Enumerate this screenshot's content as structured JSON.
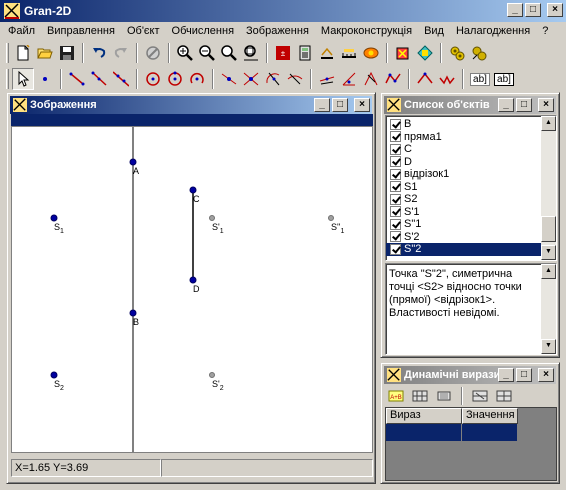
{
  "app": {
    "title": "Gran-2D"
  },
  "menu": {
    "items": [
      "Файл",
      "Виправлення",
      "Об'єкт",
      "Обчислення",
      "Зображення",
      "Макроконструкція",
      "Вид",
      "Налагодження",
      "?"
    ]
  },
  "toolbar1": {
    "icons": [
      "new-file-icon",
      "open-folder-icon",
      "save-icon",
      "undo-icon",
      "redo-icon",
      "disabled-tool-icon",
      "zoom-in-icon",
      "zoom-out-icon",
      "zoom-fit-icon",
      "zoom-window-icon",
      "calculator-icon",
      "measure-icon",
      "ruler-icon",
      "eye-icon",
      "cube-icon",
      "transform-icon",
      "macro-run-icon",
      "macro-settings-icon"
    ]
  },
  "toolbar2": {
    "icons": [
      "arrow-select-icon",
      "point-icon",
      "segment-icon",
      "ray-icon",
      "line-icon",
      "circle-icon",
      "circle-center-icon",
      "arc-icon",
      "point-on-line-icon",
      "intersection-icon",
      "parallel-icon",
      "perpendicular-icon",
      "bisector-icon",
      "angle-icon",
      "polygon-icon",
      "polyline-icon",
      "triangle-icon",
      "reflect-icon"
    ],
    "text_button_1": "ab]",
    "text_button_2": "ab]"
  },
  "drawing": {
    "title": "Зображення",
    "points": [
      {
        "label": "A",
        "sub": "",
        "style": "blue"
      },
      {
        "label": "B",
        "sub": "",
        "style": "blue"
      },
      {
        "label": "C",
        "sub": "",
        "style": "blue"
      },
      {
        "label": "D",
        "sub": "",
        "style": "blue"
      },
      {
        "label": "S",
        "sub": "1",
        "style": "blue"
      },
      {
        "label": "S'",
        "sub": "1",
        "style": "gray"
      },
      {
        "label": "S''",
        "sub": "1",
        "style": "gray"
      },
      {
        "label": "S",
        "sub": "2",
        "style": "blue"
      },
      {
        "label": "S'",
        "sub": "2",
        "style": "gray"
      }
    ],
    "status": "X=1.65 Y=3.69"
  },
  "objects": {
    "title": "Список об'єктів",
    "items": [
      "B",
      "пряма1",
      "C",
      "D",
      "відрізок1",
      "S1",
      "S2",
      "S'1",
      "S\"1",
      "S'2",
      "S\"2"
    ],
    "selected_index": 10,
    "description": "Точка \"S\"2\", симетрична точці <S2> відносно точки (прямої) <відрізок1>. Властивості невідомі."
  },
  "dynamic": {
    "title": "Динамічні вирази",
    "columns": [
      "Вираз",
      "Значення"
    ]
  },
  "colors": {
    "titlebar_active": "#0a246a",
    "point_blue": "#0000a0",
    "point_gray": "#a0a0a0"
  }
}
